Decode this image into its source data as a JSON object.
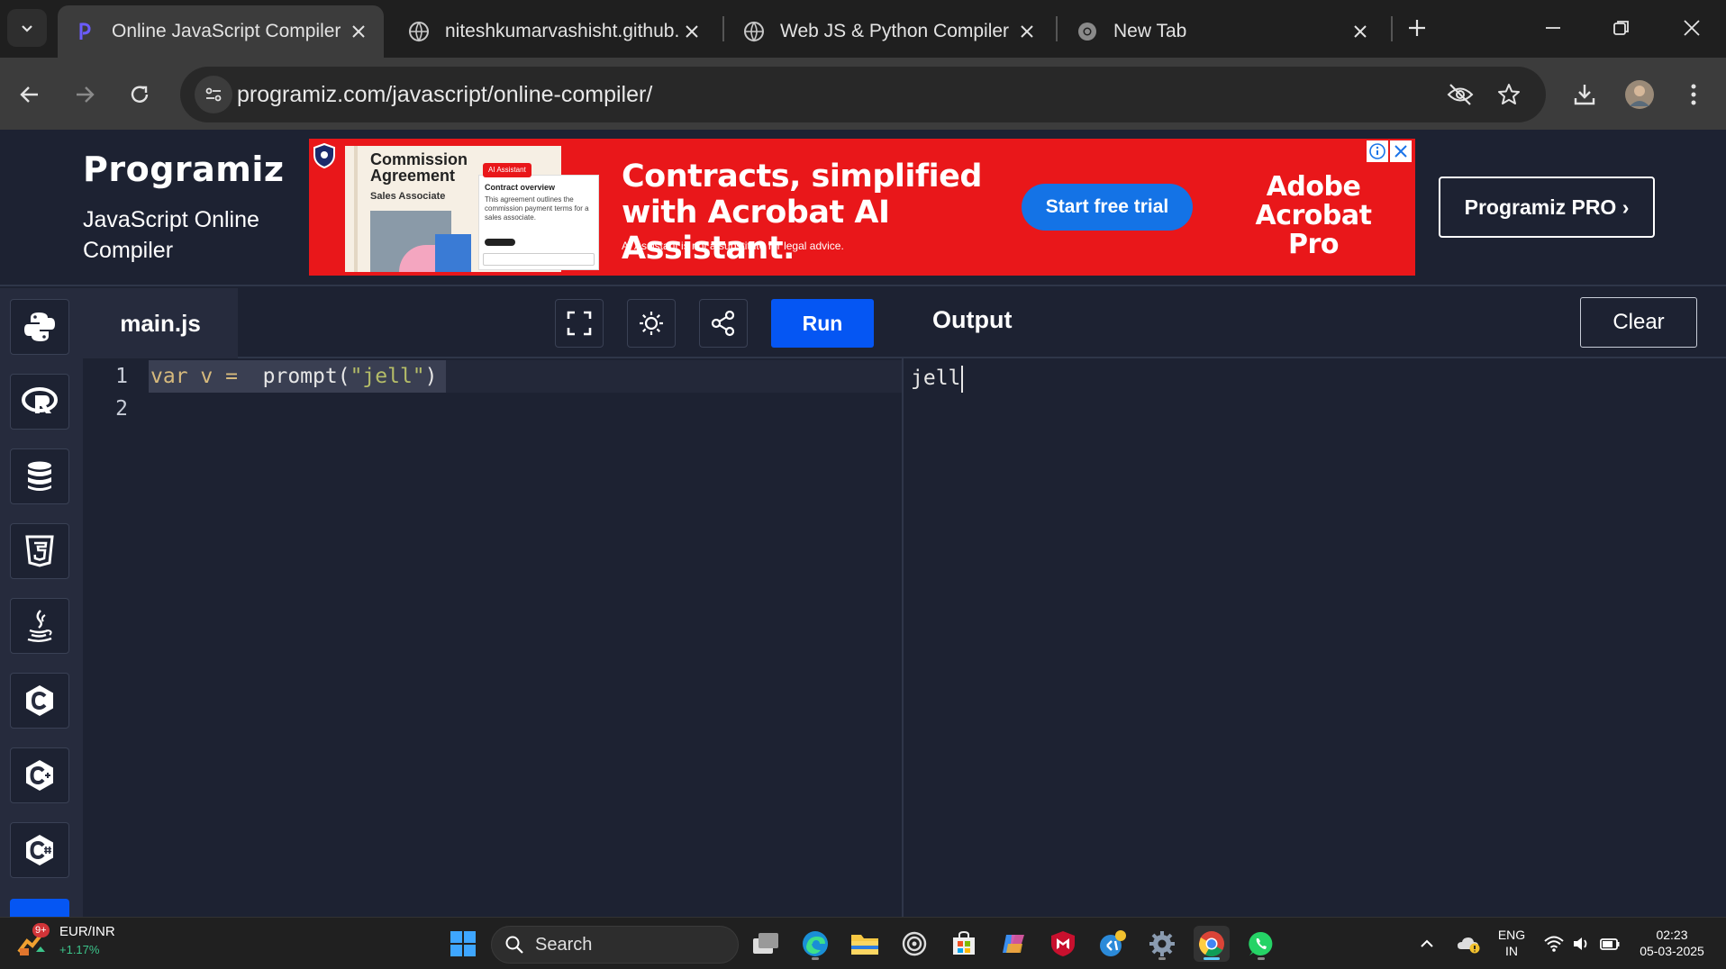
{
  "browser": {
    "tabs": [
      {
        "title": "Online JavaScript Compiler (",
        "active": true
      },
      {
        "title": "niteshkumarvashisht.github.",
        "active": false
      },
      {
        "title": "Web JS & Python Compiler",
        "active": false
      },
      {
        "title": "New Tab",
        "active": false
      }
    ],
    "url": "programiz.com/javascript/online-compiler/"
  },
  "header": {
    "logo": "Programiz",
    "page_title": "JavaScript Online Compiler",
    "pro_button": "Programiz PRO ›"
  },
  "ad": {
    "doc_title": "Commission Agreement",
    "doc_subtitle": "Sales Associate",
    "doc_badge": "AI Assistant",
    "doc_card_title": "Contract overview",
    "doc_card_text": "This agreement outlines the commission payment terms for a sales associate.",
    "headline": "Contracts, simplified with Acrobat AI Assistant.",
    "disclaimer": "AI Assistant is not a substitute for legal advice.",
    "cta": "Start free trial",
    "brand_line1": "Adobe",
    "brand_line2": "Acrobat Pro"
  },
  "rail": {
    "languages": [
      "python-icon",
      "r-icon",
      "sql-icon",
      "html5-icon",
      "java-icon",
      "c-icon",
      "cpp-icon",
      "csharp-icon"
    ]
  },
  "editor": {
    "file_name": "main.js",
    "run_label": "Run",
    "lines": [
      {
        "number": "1",
        "text": "var v =  prompt(\"jell\")"
      },
      {
        "number": "2",
        "text": ""
      }
    ],
    "code_kw": "var v =",
    "code_fn": "  prompt(",
    "code_str": "\"jell\"",
    "code_end": ")"
  },
  "output": {
    "title": "Output",
    "clear_label": "Clear",
    "text": "jell"
  },
  "taskbar": {
    "widget_title": "EUR/INR",
    "widget_change": "+1.17%",
    "widget_badge": "9+",
    "search_placeholder": "Search",
    "lang_line1": "ENG",
    "lang_line2": "IN",
    "time": "02:23",
    "date": "05-03-2025"
  },
  "colors": {
    "page_bg": "#1d2232",
    "accent_blue": "#0556f3",
    "ad_red": "#e9171a",
    "ad_button_blue": "#1473e6"
  }
}
